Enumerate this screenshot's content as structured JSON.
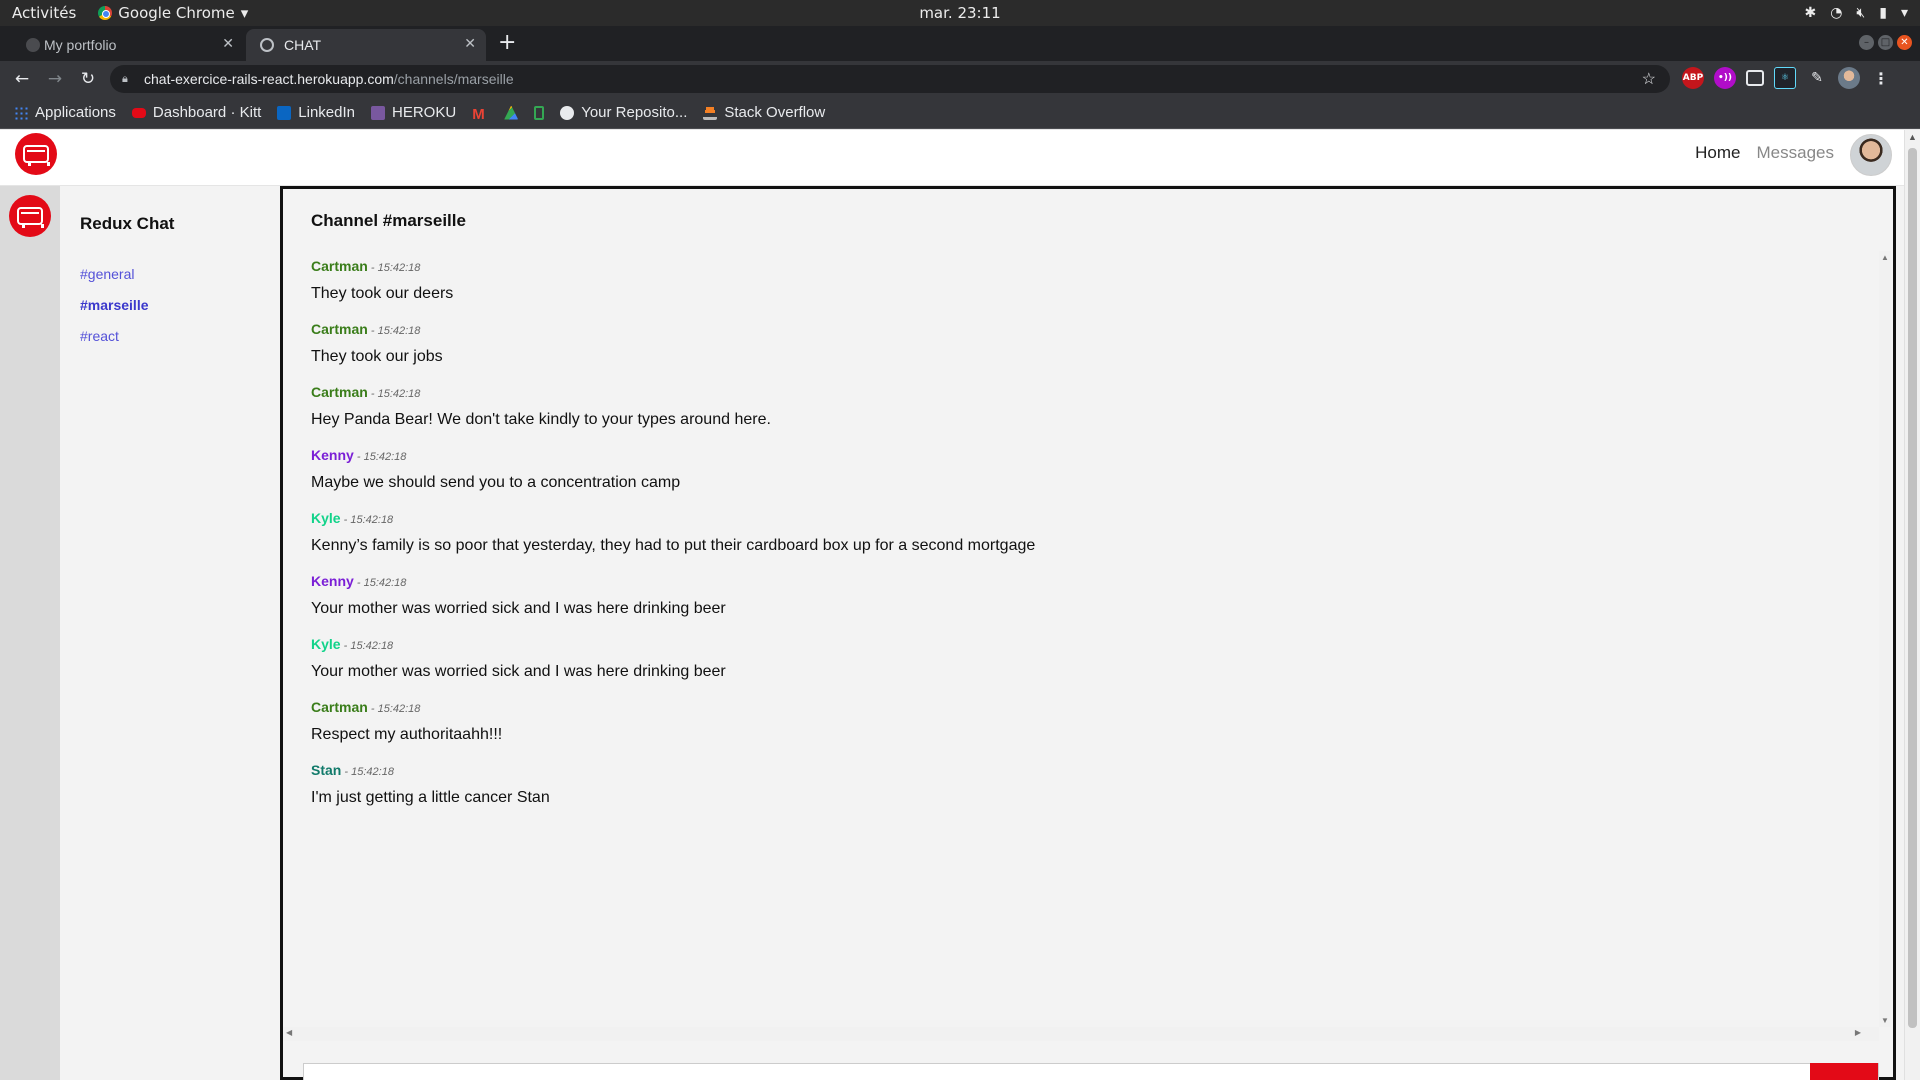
{
  "os_bar": {
    "activities": "Activités",
    "app_name": "Google Chrome",
    "clock": "mar. 23:11"
  },
  "browser": {
    "tabs": [
      {
        "title": "My portfolio",
        "active": false
      },
      {
        "title": "CHAT",
        "active": true
      }
    ],
    "new_tab": "+",
    "url_host": "chat-exercice-rails-react.herokuapp.com",
    "url_path": "/channels/marseille",
    "extensions": [
      "ABP",
      "•))"
    ],
    "bookmarks": [
      {
        "label": "Applications",
        "icon": "apps-grid-icon",
        "color": "#4285f4"
      },
      {
        "label": "Dashboard · Kitt",
        "icon": "bus-icon",
        "color": "#e30a17"
      },
      {
        "label": "LinkedIn",
        "icon": "linkedin-icon",
        "color": "#0a66c2"
      },
      {
        "label": "HEROKU",
        "icon": "heroku-icon",
        "color": "#79589f"
      },
      {
        "label": "",
        "icon": "gmail-icon",
        "color": "#ea4335"
      },
      {
        "label": "",
        "icon": "drive-icon",
        "color": "#fbbc04"
      },
      {
        "label": "",
        "icon": "phone-icon",
        "color": "#34a853"
      },
      {
        "label": "Your Reposito...",
        "icon": "github-icon",
        "color": "#e8eaed"
      },
      {
        "label": "Stack Overflow",
        "icon": "stackoverflow-icon",
        "color": "#f48024"
      }
    ]
  },
  "app": {
    "nav": {
      "home": "Home",
      "messages": "Messages"
    },
    "sidebar": {
      "title": "Redux Chat",
      "channels": [
        {
          "label": "#general",
          "active": false
        },
        {
          "label": "#marseille",
          "active": true
        },
        {
          "label": "#react",
          "active": false
        }
      ]
    },
    "chat": {
      "title": "Channel #marseille",
      "messages": [
        {
          "author": "Cartman",
          "time": "15:42:18",
          "color": "#3a7d1a",
          "content": "They took our deers"
        },
        {
          "author": "Cartman",
          "time": "15:42:18",
          "color": "#3a7d1a",
          "content": "They took our jobs"
        },
        {
          "author": "Cartman",
          "time": "15:42:18",
          "color": "#3a7d1a",
          "content": "Hey Panda Bear! We don't take kindly to your types around here."
        },
        {
          "author": "Kenny",
          "time": "15:42:18",
          "color": "#7b1fd6",
          "content": "Maybe we should send you to a concentration camp"
        },
        {
          "author": "Kyle",
          "time": "15:42:18",
          "color": "#12d38a",
          "content": "Kenny’s family is so poor that yesterday, they had to put their cardboard box up for a second mortgage"
        },
        {
          "author": "Kenny",
          "time": "15:42:18",
          "color": "#7b1fd6",
          "content": "Your mother was worried sick and I was here drinking beer"
        },
        {
          "author": "Kyle",
          "time": "15:42:18",
          "color": "#12d38a",
          "content": "Your mother was worried sick and I was here drinking beer"
        },
        {
          "author": "Cartman",
          "time": "15:42:18",
          "color": "#3a7d1a",
          "content": "Respect my authoritaahh!!!"
        },
        {
          "author": "Stan",
          "time": "15:42:18",
          "color": "#117a6a",
          "content": "I'm just getting a little cancer Stan"
        }
      ]
    }
  }
}
